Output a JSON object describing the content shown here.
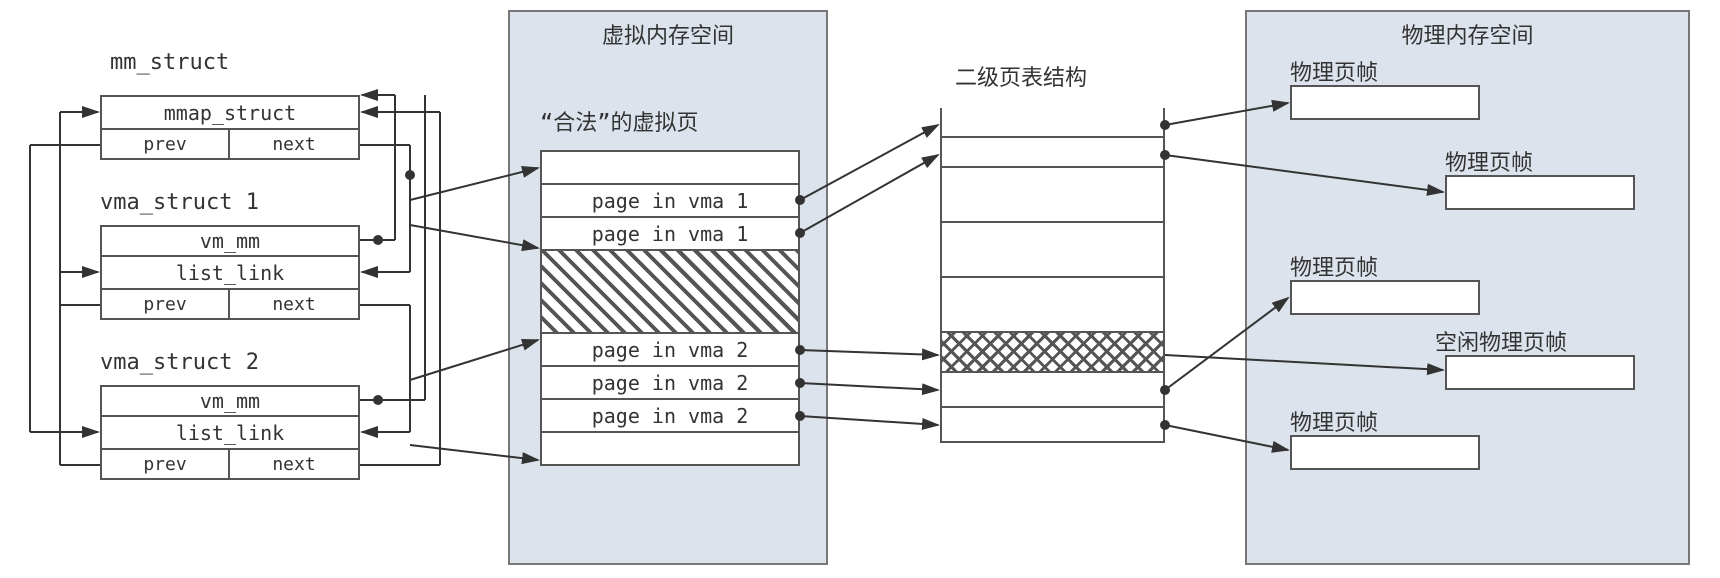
{
  "left": {
    "title": "mm_struct",
    "mmap": {
      "label": "mmap_struct",
      "prev": "prev",
      "next": "next"
    },
    "vma1_title": "vma_struct 1",
    "vma1": {
      "vm_mm": "vm_mm",
      "list_link": "list_link",
      "prev": "prev",
      "next": "next"
    },
    "vma2_title": "vma_struct 2",
    "vma2": {
      "vm_mm": "vm_mm",
      "list_link": "list_link",
      "prev": "prev",
      "next": "next"
    }
  },
  "vpanel": {
    "title": "虚拟内存空间",
    "subtitle": "“合法”的虚拟页",
    "rows": [
      "page in vma 1",
      "page in vma 1",
      "",
      "",
      "page in vma 2",
      "page in vma 2",
      "page in vma 2"
    ]
  },
  "ptable_title": "二级页表结构",
  "ppanel": {
    "title": "物理内存空间",
    "frames": [
      "物理页帧",
      "物理页帧",
      "物理页帧",
      "空闲物理页帧",
      "物理页帧"
    ]
  }
}
